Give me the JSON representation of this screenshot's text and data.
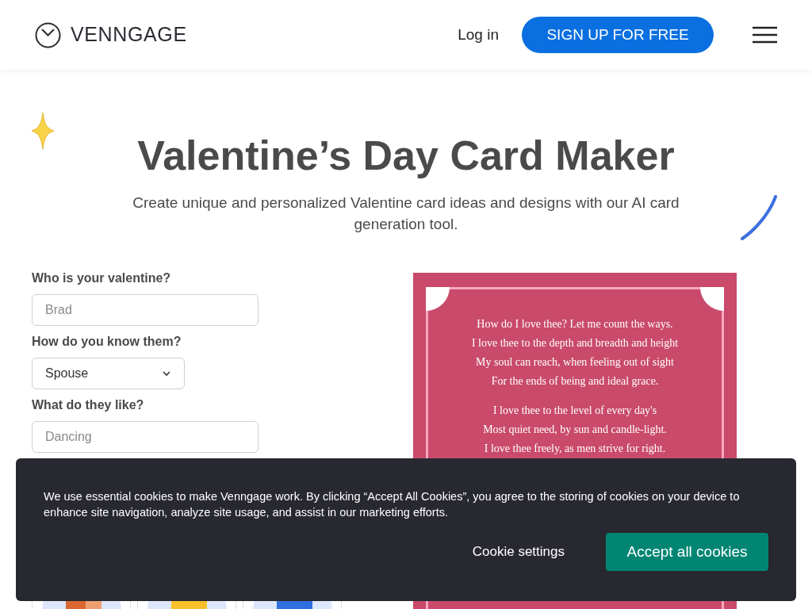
{
  "header": {
    "brand": "VENNGAGE",
    "login": "Log in",
    "signup": "SIGN UP FOR FREE"
  },
  "hero": {
    "title": "Valentine’s Day Card Maker",
    "subtitle": "Create unique and personalized Valentine card ideas and designs with our AI card generation tool."
  },
  "form": {
    "fields": [
      {
        "kind": "text",
        "label": "Who is your valentine?",
        "placeholder": "Brad"
      },
      {
        "kind": "select",
        "label": "How do you know them?",
        "value": "Spouse"
      },
      {
        "kind": "text",
        "label": "What do they like?",
        "placeholder": "Dancing"
      }
    ]
  },
  "card": {
    "stanzas": [
      [
        "How do I love thee? Let me count the ways.",
        "I love thee to the depth and breadth and height",
        "My soul can reach, when feeling out of sight",
        "For the ends of being and ideal grace."
      ],
      [
        "I love thee to the level of every day's",
        "Most quiet need, by sun and candle-light.",
        "I love thee freely, as men strive for right."
      ]
    ]
  },
  "cookie_banner": {
    "message": "We use essential cookies to make Venngage work. By clicking “Accept All Cookies”, you agree to the storing of cookies on your device to enhance site navigation, analyze site usage, and assist in our marketing efforts.",
    "settings": "Cookie settings",
    "accept": "Accept all cookies"
  }
}
